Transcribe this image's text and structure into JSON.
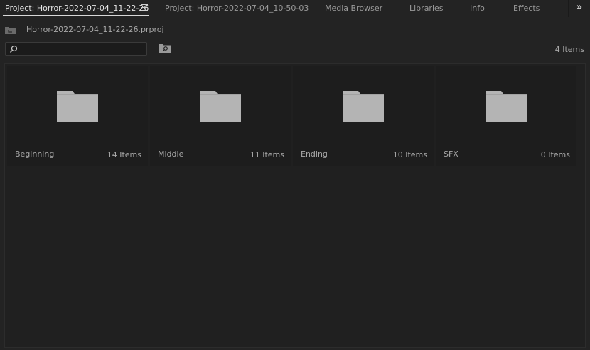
{
  "tabs": [
    {
      "label": "Project: Horror-2022-07-04_11-22-26",
      "active": true
    },
    {
      "label": "Project: Horror-2022-07-04_10-50-03",
      "active": false
    },
    {
      "label": "Media Browser",
      "active": false
    },
    {
      "label": "Libraries",
      "active": false
    },
    {
      "label": "Info",
      "active": false
    },
    {
      "label": "Effects",
      "active": false
    }
  ],
  "overflow_label": "»",
  "project_path": "Horror-2022-07-04_11-22-26.prproj",
  "search": {
    "value": "",
    "placeholder": ""
  },
  "item_count": "4 Items",
  "bins": [
    {
      "name": "Beginning",
      "count": "14 Items"
    },
    {
      "name": "Middle",
      "count": "11 Items"
    },
    {
      "name": "Ending",
      "count": "10 Items"
    },
    {
      "name": "SFX",
      "count": "0 Items"
    }
  ],
  "colors": {
    "background": "#232323",
    "tile": "#1d1d1d",
    "folder": "#b4b4b4",
    "text": "#a8a8a8",
    "active_tab": "#e4e4e4"
  }
}
